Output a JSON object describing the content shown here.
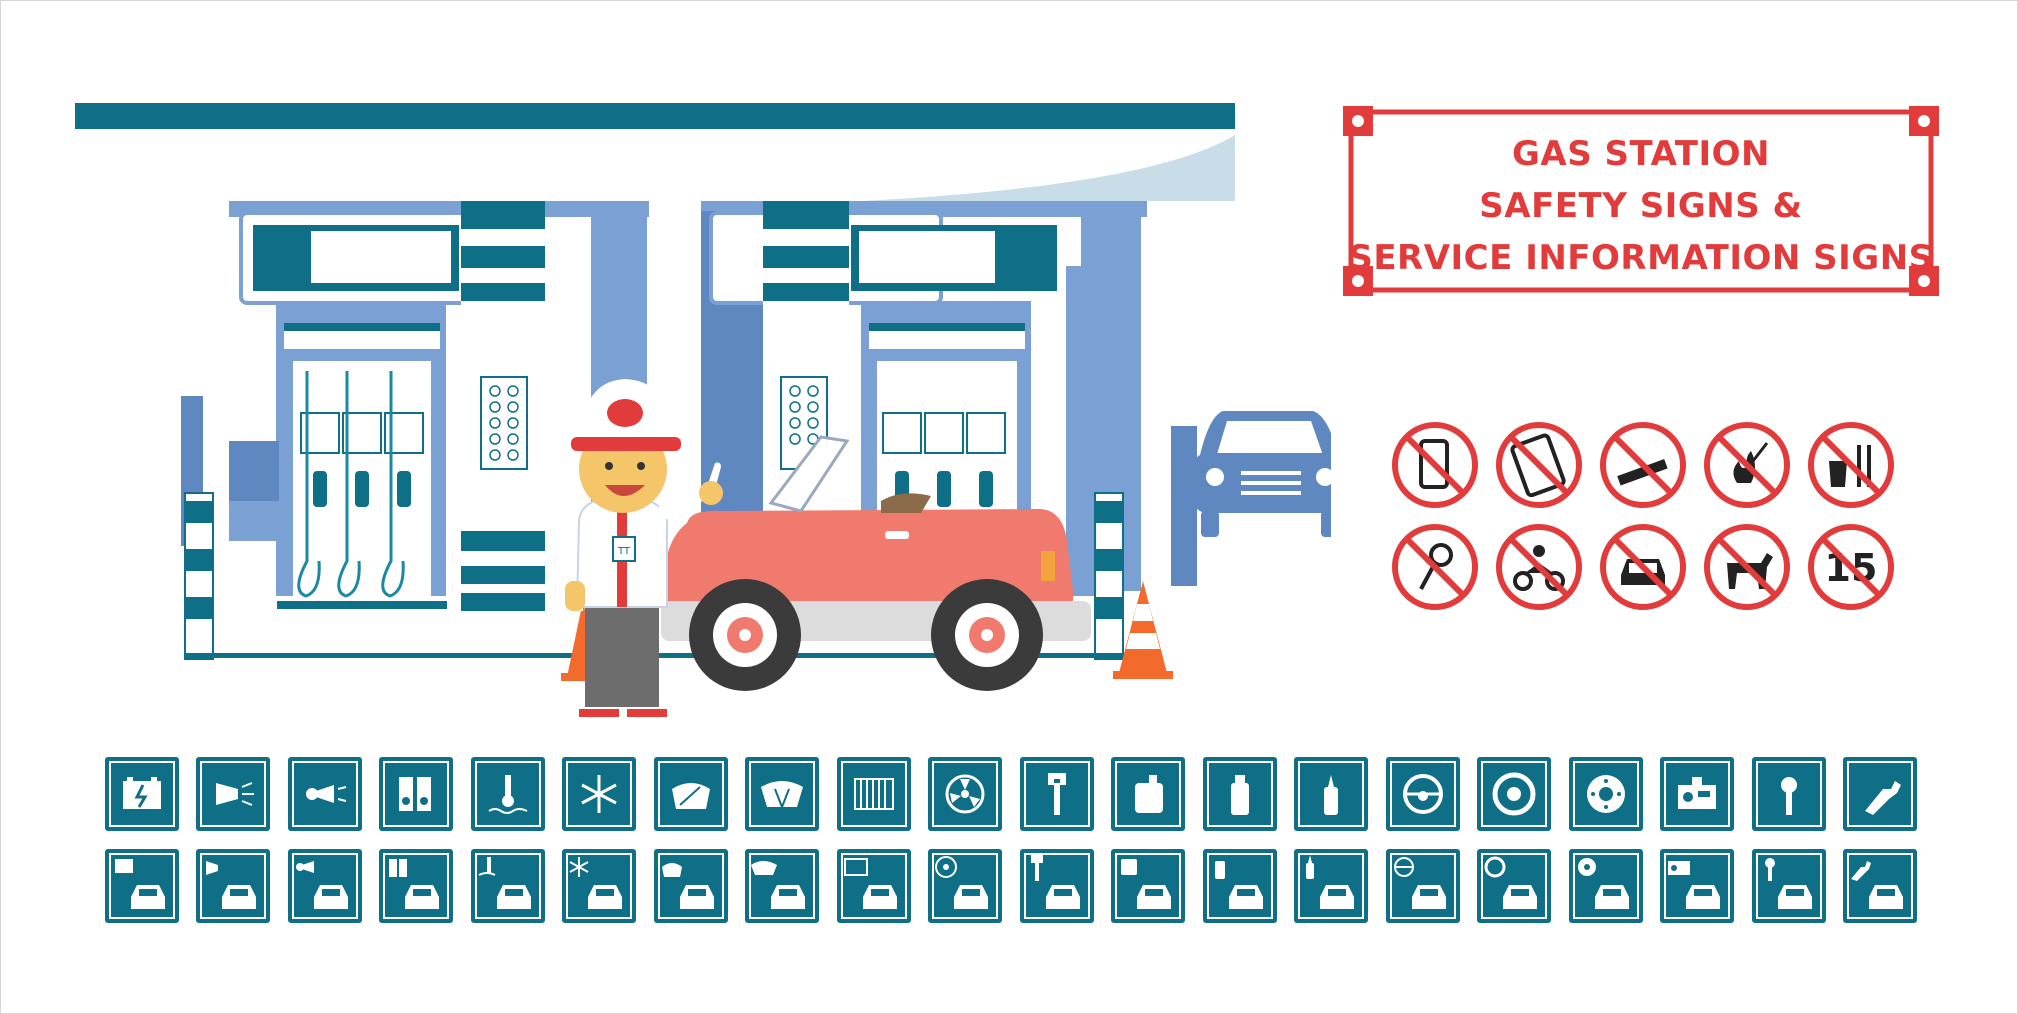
{
  "title": {
    "line1": "GAS STATION",
    "line2": "SAFETY SIGNS &",
    "line3": "SERVICE INFORMATION SIGNS"
  },
  "colors": {
    "teal": "#0e6f87",
    "blue": "#7ba1d4",
    "red": "#e23b3b",
    "car_red": "#ef7a6d",
    "cone": "#f26b2d"
  },
  "prohibition_signs": [
    {
      "icon": "no-phone-icon"
    },
    {
      "icon": "no-tablet-icon"
    },
    {
      "icon": "no-smoking-icon"
    },
    {
      "icon": "no-matches-icon"
    },
    {
      "icon": "no-food-drink-icon"
    },
    {
      "icon": "no-keys-icon"
    },
    {
      "icon": "no-motorbike-icon"
    },
    {
      "icon": "no-car-icon"
    },
    {
      "icon": "no-dogs-icon"
    },
    {
      "icon": "no-speed-15-icon",
      "text": "15"
    }
  ],
  "service_icons": [
    "battery-icon",
    "headlight-icon",
    "horn-icon",
    "speaker-icon",
    "coolant-icon",
    "air-conditioning-icon",
    "wiper-icon",
    "windshield-icon",
    "radiator-icon",
    "fan-icon",
    "wrench-icon",
    "oil-can-icon",
    "spray-can-icon",
    "lubricant-icon",
    "steering-wheel-icon",
    "tire-icon",
    "brake-disc-icon",
    "car-radio-icon",
    "tire-pressure-icon",
    "fuel-nozzle-icon"
  ],
  "service_icons_with_car": [
    "battery-car-icon",
    "headlight-car-icon",
    "horn-car-icon",
    "speaker-car-icon",
    "coolant-car-icon",
    "air-conditioning-car-icon",
    "wiper-car-icon",
    "windshield-car-icon",
    "radiator-car-icon",
    "fan-car-icon",
    "wrench-car-icon",
    "oil-can-car-icon",
    "spray-can-car-icon",
    "lubricant-car-icon",
    "steering-wheel-car-icon",
    "tire-car-icon",
    "brake-disc-car-icon",
    "car-radio-car-icon",
    "tire-pressure-car-icon",
    "fuel-nozzle-car-icon"
  ],
  "attendant": {
    "badge": "TT"
  }
}
